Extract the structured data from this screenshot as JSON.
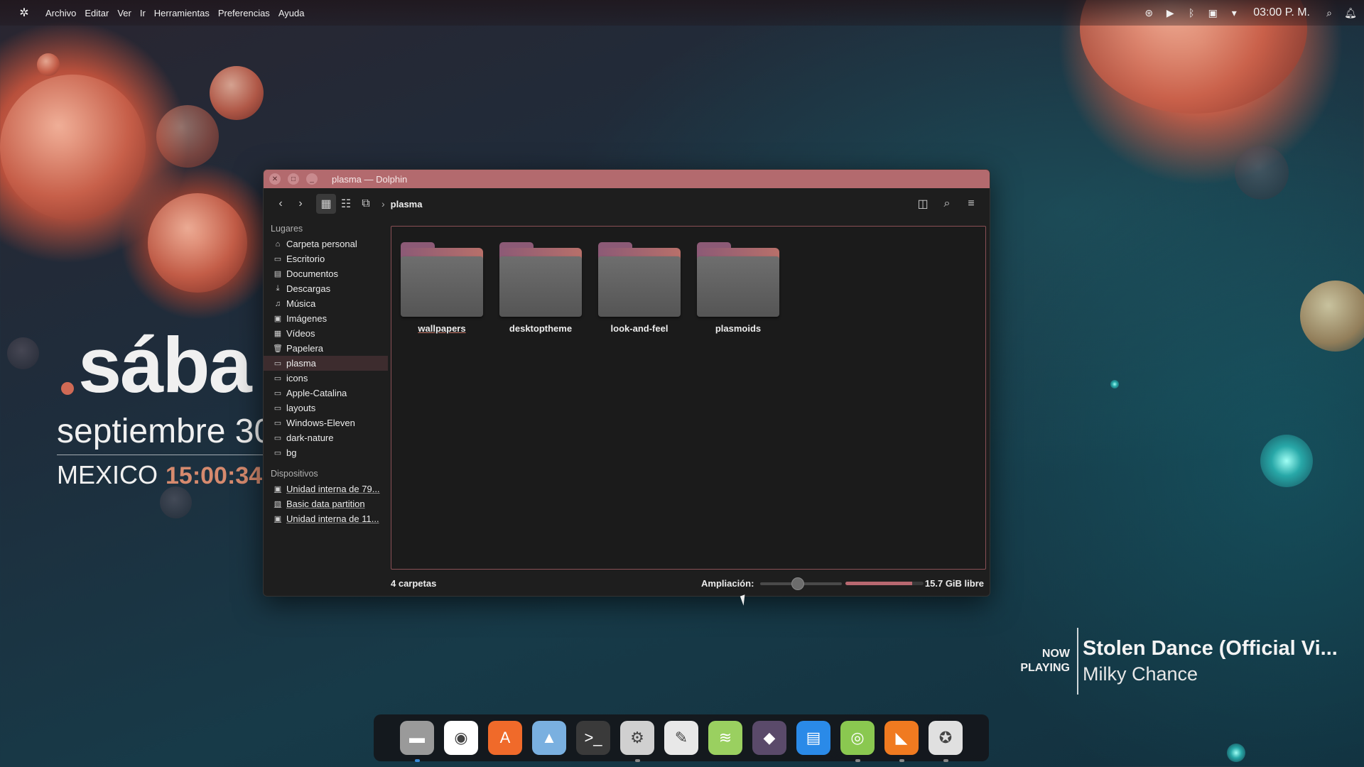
{
  "menubar": {
    "items": [
      "Archivo",
      "Editar",
      "Ver",
      "Ir",
      "Herramientas",
      "Preferencias",
      "Ayuda"
    ],
    "clock": "03:00 P. M."
  },
  "desktop_widget": {
    "day": "sába",
    "date": "septiembre 30",
    "location": "MEXICO",
    "time": "15:00:34"
  },
  "now_playing": {
    "label_line1": "NOW",
    "label_line2": "PLAYING",
    "title": "Stolen Dance (Official Vi...",
    "artist": "Milky Chance"
  },
  "window": {
    "title": "plasma — Dolphin",
    "breadcrumb_current": "plasma",
    "sidebar": {
      "places_heading": "Lugares",
      "places": [
        {
          "label": "Carpeta personal",
          "icon": "home-icon"
        },
        {
          "label": "Escritorio",
          "icon": "desktop-icon"
        },
        {
          "label": "Documentos",
          "icon": "documents-icon"
        },
        {
          "label": "Descargas",
          "icon": "download-icon"
        },
        {
          "label": "Música",
          "icon": "music-icon"
        },
        {
          "label": "Imágenes",
          "icon": "image-icon"
        },
        {
          "label": "Vídeos",
          "icon": "video-icon"
        },
        {
          "label": "Papelera",
          "icon": "trash-icon"
        },
        {
          "label": "plasma",
          "icon": "folder-icon",
          "selected": true
        },
        {
          "label": "icons",
          "icon": "folder-icon"
        },
        {
          "label": "Apple-Catalina",
          "icon": "folder-icon"
        },
        {
          "label": "layouts",
          "icon": "folder-icon"
        },
        {
          "label": "Windows-Eleven",
          "icon": "folder-icon"
        },
        {
          "label": "dark-nature",
          "icon": "folder-icon"
        },
        {
          "label": "bg",
          "icon": "folder-icon"
        }
      ],
      "devices_heading": "Dispositivos",
      "devices": [
        {
          "label": "Unidad interna de 79...",
          "icon": "drive-icon"
        },
        {
          "label": "Basic data partition",
          "icon": "partition-icon"
        },
        {
          "label": "Unidad interna de 11...",
          "icon": "drive-icon"
        }
      ]
    },
    "folders": [
      "wallpapers",
      "desktoptheme",
      "look-and-feel",
      "plasmoids"
    ],
    "status": {
      "count": "4 carpetas",
      "zoom_label": "Ampliación:",
      "zoom_level": 0.45,
      "free_space": "15.7 GiB libre",
      "used_fraction": 0.85
    }
  },
  "dock": {
    "apps": [
      {
        "name": "files-app",
        "color": "#9a9a9a",
        "glyph": "▬",
        "running": true
      },
      {
        "name": "chrome-app",
        "color": "#ffffff",
        "glyph": "◉",
        "running": false
      },
      {
        "name": "app-store-app",
        "color": "#f06a2a",
        "glyph": "A",
        "running": false
      },
      {
        "name": "image-viewer-app",
        "color": "#7ab0e0",
        "glyph": "▲",
        "running": false
      },
      {
        "name": "terminal-app",
        "color": "#3a3a3a",
        "glyph": ">_",
        "running": false
      },
      {
        "name": "settings-app",
        "color": "#d0d0d0",
        "glyph": "⚙",
        "running": true
      },
      {
        "name": "text-editor-app",
        "color": "#e8e8e8",
        "glyph": "✎",
        "running": false
      },
      {
        "name": "spotify-app",
        "color": "#9ad060",
        "glyph": "≋",
        "running": false
      },
      {
        "name": "discover-app",
        "color": "#5a4a6a",
        "glyph": "◆",
        "running": false
      },
      {
        "name": "calendar-app",
        "color": "#2a8ae8",
        "glyph": "▤",
        "running": false
      },
      {
        "name": "music-player-app",
        "color": "#8ac850",
        "glyph": "◎",
        "running": true
      },
      {
        "name": "video-app",
        "color": "#f07a20",
        "glyph": "◣",
        "running": true
      },
      {
        "name": "gimp-app",
        "color": "#e0e0e0",
        "glyph": "✪",
        "running": true
      }
    ]
  }
}
